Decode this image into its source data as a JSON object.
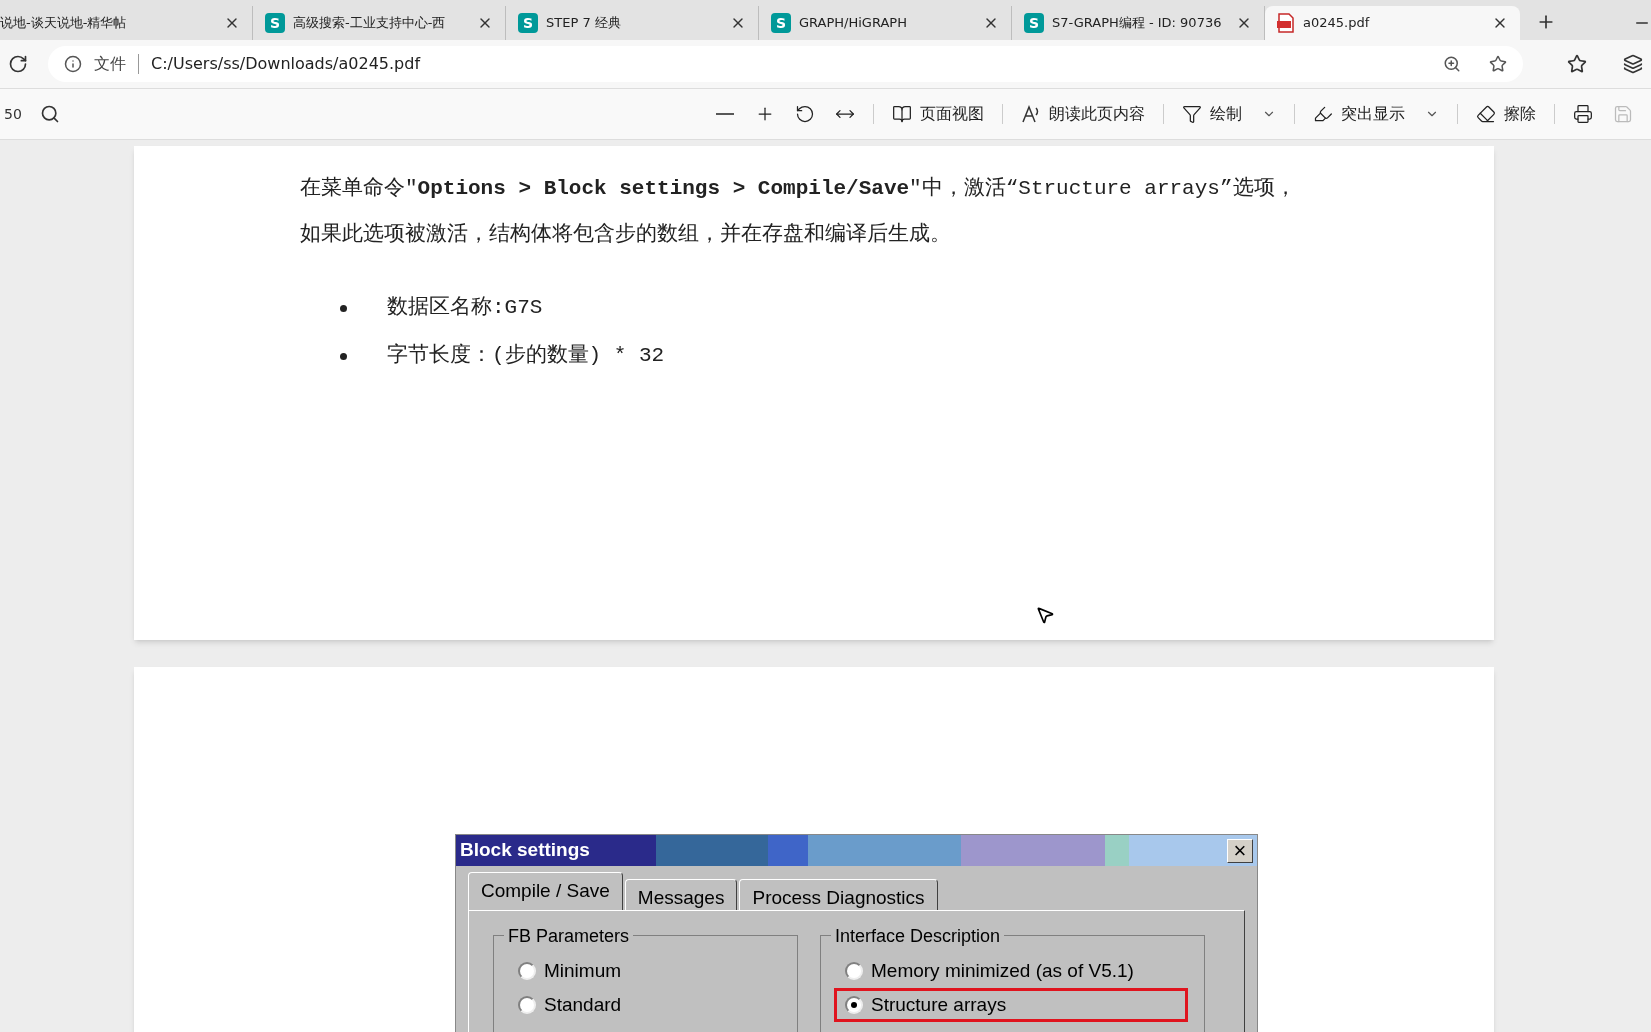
{
  "tabs": [
    {
      "title": "说地-谈天说地-精华帖",
      "kind": "site",
      "selected": false
    },
    {
      "title": "高级搜索-工业支持中心-西",
      "kind": "site",
      "badge": "S",
      "selected": false
    },
    {
      "title": "STEP 7 经典",
      "kind": "site",
      "badge": "S",
      "selected": false
    },
    {
      "title": "GRAPH/HiGRAPH",
      "kind": "site",
      "badge": "S",
      "selected": false
    },
    {
      "title": "S7-GRAPH编程 - ID: 90736",
      "kind": "site",
      "badge": "S",
      "selected": false
    },
    {
      "title": "a0245.pdf",
      "kind": "pdf",
      "selected": true
    }
  ],
  "address_bar": {
    "scheme_label": "文件",
    "url": "C:/Users/ss/Downloads/a0245.pdf"
  },
  "pdf_toolbar": {
    "page_number": "50",
    "tools": [
      {
        "kind": "zoom-out"
      },
      {
        "kind": "zoom-in"
      },
      {
        "kind": "rotate"
      },
      {
        "kind": "fit"
      },
      {
        "kind": "page-view",
        "label": "页面视图"
      },
      {
        "kind": "read-aloud",
        "label": "朗读此页内容"
      },
      {
        "kind": "draw",
        "label": "绘制",
        "dropdown": true
      },
      {
        "kind": "highlight",
        "label": "突出显示",
        "dropdown": true
      },
      {
        "kind": "erase",
        "label": "擦除"
      },
      {
        "kind": "print"
      },
      {
        "kind": "save",
        "disabled": true
      }
    ]
  },
  "document": {
    "paragraph": [
      "在菜单命令″**Options > Block settings > Compile/Save**″中，激活“Structure arrays”选项，",
      "如果此选项被激活，结构体将包含步的数组，并在存盘和编译后生成。"
    ],
    "bullets": [
      "数据区名称:G7S",
      "字节长度：(步的数量) * 32"
    ]
  },
  "dialog": {
    "title": "Block settings",
    "close": "×",
    "tabs": [
      {
        "label": "Compile / Save",
        "selected": true
      },
      {
        "label": "Messages",
        "selected": false
      },
      {
        "label": "Process Diagnostics",
        "selected": false
      }
    ],
    "groups": [
      {
        "title": "FB Parameters",
        "options": [
          {
            "label": "Minimum",
            "selected": false,
            "highlighted": false
          },
          {
            "label": "Standard",
            "selected": false,
            "highlighted": false
          }
        ]
      },
      {
        "title": "Interface Description",
        "options": [
          {
            "label": "Memory minimized (as of V5.1)",
            "selected": false,
            "highlighted": false
          },
          {
            "label": "Structure arrays",
            "selected": true,
            "highlighted": true
          }
        ]
      }
    ]
  }
}
